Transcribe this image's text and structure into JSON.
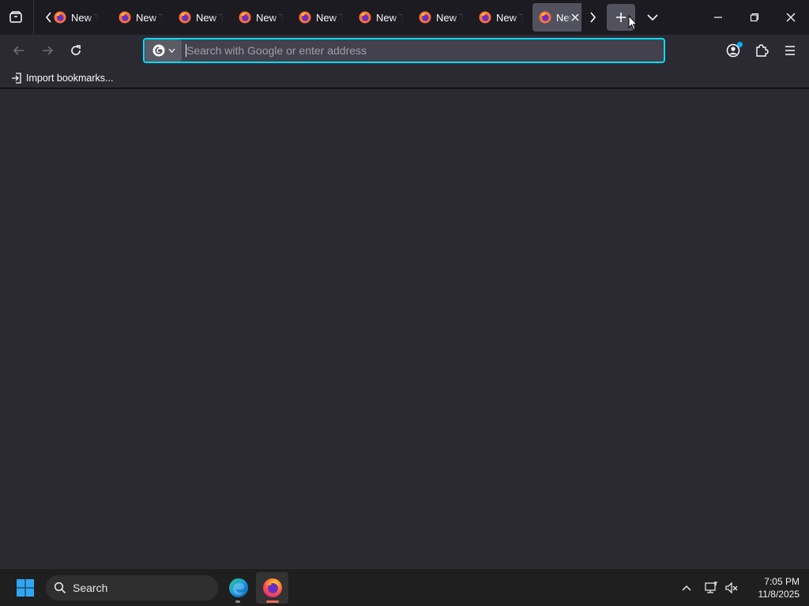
{
  "tabbar": {
    "tabs": [
      {
        "label": "New T",
        "active": false
      },
      {
        "label": "New T",
        "active": false
      },
      {
        "label": "New T",
        "active": false
      },
      {
        "label": "New T",
        "active": false
      },
      {
        "label": "New T",
        "active": false
      },
      {
        "label": "New T",
        "active": false
      },
      {
        "label": "New T",
        "active": false
      },
      {
        "label": "New T",
        "active": false
      },
      {
        "label": "New Tab",
        "active": true
      }
    ]
  },
  "navbar": {
    "search_engine": "google-icon",
    "url_placeholder": "Search with Google or enter address",
    "url_value": ""
  },
  "bookmarks": {
    "import_label": "Import bookmarks..."
  },
  "taskbar": {
    "search_label": "Search",
    "time": "7:05 PM",
    "date": "11/8/2025"
  },
  "colors": {
    "accent": "#00ddff",
    "toolbar": "#2b2a33",
    "tabstrip": "#1c1b22",
    "active_tab": "#52525e"
  }
}
